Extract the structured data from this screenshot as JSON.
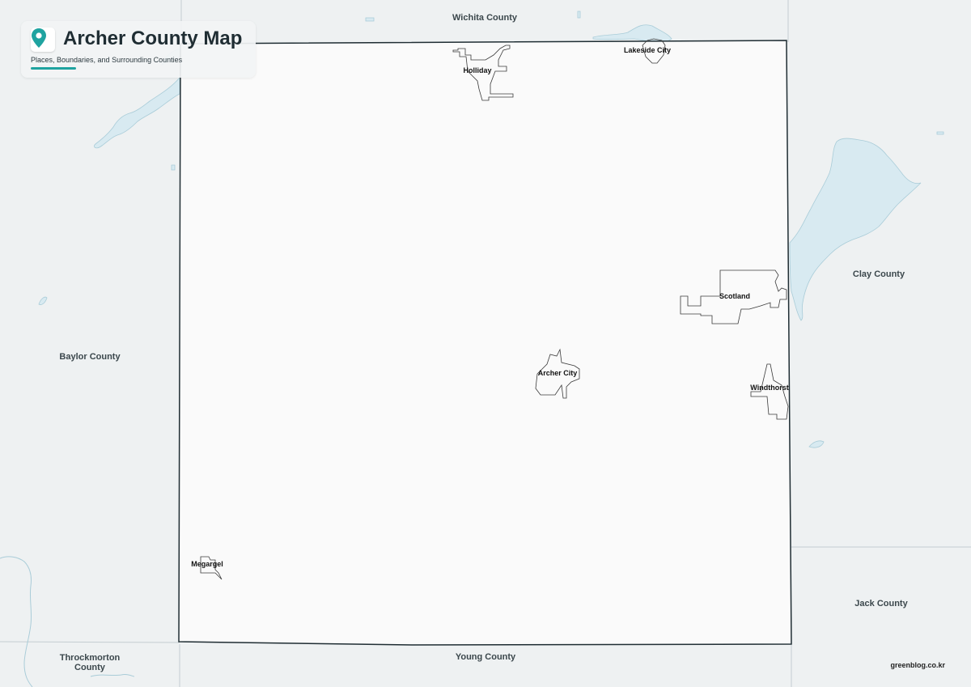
{
  "header": {
    "title": "Archer County Map",
    "subtitle": "Places, Boundaries, and Surrounding Counties",
    "pin_icon": "map-pin-icon",
    "accent_color": "#1fa3a0"
  },
  "colors": {
    "background": "#eef1f2",
    "county_fill": "#fafafa",
    "county_border": "#1f2d33",
    "water": "#d8eaf1",
    "water_edge": "#a9ccd8",
    "boundary_lines": "#c4cdd1"
  },
  "counties": {
    "wichita": "Wichita County",
    "clay": "Clay County",
    "baylor": "Baylor County",
    "jack": "Jack County",
    "young": "Young County",
    "throckmorton": "Throckmorton\nCounty"
  },
  "places": {
    "holliday": "Holliday",
    "lakeside_city": "Lakeside City",
    "scotland": "Scotland",
    "archer_city": "Archer City",
    "windthorst": "Windthorst",
    "megargel": "Megargel"
  },
  "footer": {
    "credit": "greenblog.co.kr"
  }
}
